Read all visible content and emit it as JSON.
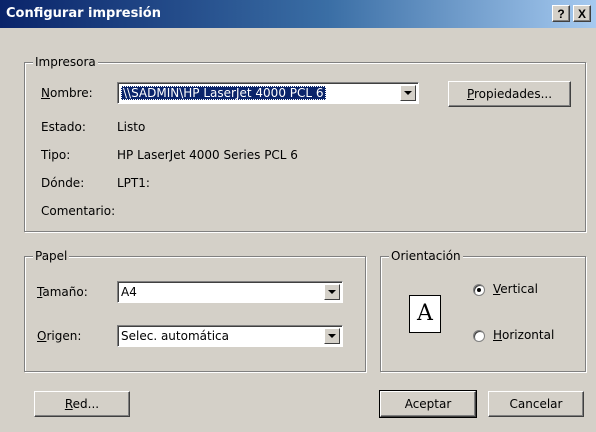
{
  "window": {
    "title": "Configurar impresión",
    "help_label": "?",
    "close_label": "X"
  },
  "printer": {
    "group_label": "Impresora",
    "name_label": "Nombre:",
    "name_value": "\\\\SADMIN\\HP LaserJet 4000 PCL 6",
    "properties_button": "Propiedades...",
    "status_label": "Estado:",
    "status_value": "Listo",
    "type_label": "Tipo:",
    "type_value": "HP LaserJet 4000 Series PCL 6",
    "where_label": "Dónde:",
    "where_value": "LPT1:",
    "comment_label": "Comentario:",
    "comment_value": ""
  },
  "paper": {
    "group_label": "Papel",
    "size_label": "Tamaño:",
    "size_value": "A4",
    "source_label": "Origen:",
    "source_value": "Selec. automática"
  },
  "orientation": {
    "group_label": "Orientación",
    "icon_letter": "A",
    "options": [
      {
        "label": "Vertical",
        "checked": true
      },
      {
        "label": "Horizontal",
        "checked": false
      }
    ]
  },
  "buttons": {
    "network": "Red...",
    "ok": "Aceptar",
    "cancel": "Cancelar"
  },
  "colors": {
    "title_start": "#0a246a",
    "title_end": "#a6caf0",
    "face": "#d4d0c8",
    "selection": "#0a246a"
  }
}
